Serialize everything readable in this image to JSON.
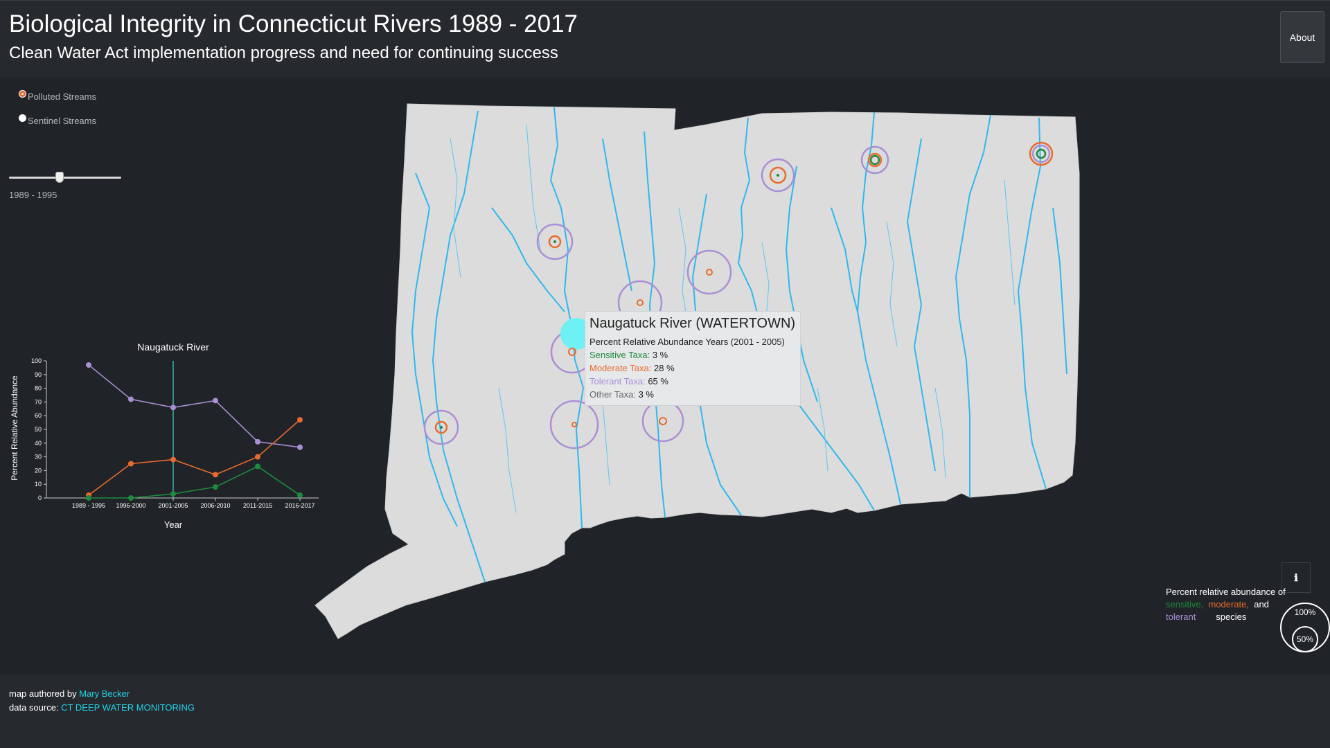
{
  "header": {
    "title": "Biological Integrity in Connecticut Rivers 1989 - 2017",
    "subtitle": "Clean Water Act implementation progress and need for continuing success",
    "about_label": "About"
  },
  "controls": {
    "radio_polluted": "Polluted Streams",
    "radio_sentinel": "Sentinel Streams",
    "selected": "Polluted Streams",
    "slider": {
      "label": "1989 - 1995",
      "position": 0.45
    }
  },
  "chart_data": {
    "type": "line",
    "title": "Naugatuck River",
    "xlabel": "Year",
    "ylabel": "Percent Relative Abundance",
    "categories": [
      "1989 - 1995",
      "1996-2000",
      "2001-2005",
      "2006-2010",
      "2011-2015",
      "2016-2017"
    ],
    "ylim": [
      0,
      100
    ],
    "yticks": [
      0,
      10,
      20,
      30,
      40,
      50,
      60,
      70,
      80,
      90,
      100
    ],
    "selected_category": "2001-2005",
    "series": [
      {
        "color": "#a98fd4",
        "values": [
          97,
          72,
          66,
          71,
          41,
          37
        ]
      },
      {
        "color": "#e86b2d",
        "values": [
          2,
          25,
          28,
          17,
          30,
          57
        ]
      },
      {
        "color": "#1e8a3e",
        "values": [
          0,
          0,
          3,
          8,
          23,
          2
        ]
      }
    ]
  },
  "tooltip": {
    "title": "Naugatuck River (WATERTOWN)",
    "years": "Percent Relative Abundance Years (2001 - 2005)",
    "rows": [
      {
        "label": "Sensitive Taxa:",
        "value": "3 %",
        "color": "#1e8a3e"
      },
      {
        "label": "Moderate Taxa:",
        "value": "28 %",
        "color": "#e86b2d"
      },
      {
        "label": "Tolerant Taxa:",
        "value": "65 %",
        "color": "#a98fd4"
      },
      {
        "label": "Other Taxa:",
        "value": "3 %",
        "color": "#666666"
      }
    ]
  },
  "legend": {
    "line1": "Percent relative abundance of",
    "sensitive": "sensitive,",
    "moderate": "moderate,",
    "and": "and",
    "tolerant": "tolerant",
    "species": "species",
    "ring_100": "100%",
    "ring_50": "50%",
    "info_icon": "info-icon",
    "colors": {
      "sensitive": "#1e8a3e",
      "moderate": "#e86b2d",
      "tolerant": "#a98fd4"
    }
  },
  "footer": {
    "authored_prefix": "map authored by",
    "author": "Mary Becker",
    "source_prefix": "data source:",
    "source": "CT DEEP WATER MONITORING"
  },
  "colors": {
    "accent_link": "#22d3e8",
    "map_fill": "#dcdcdc",
    "river": "#2fb8ee",
    "highlight": "#6ff0f5"
  }
}
